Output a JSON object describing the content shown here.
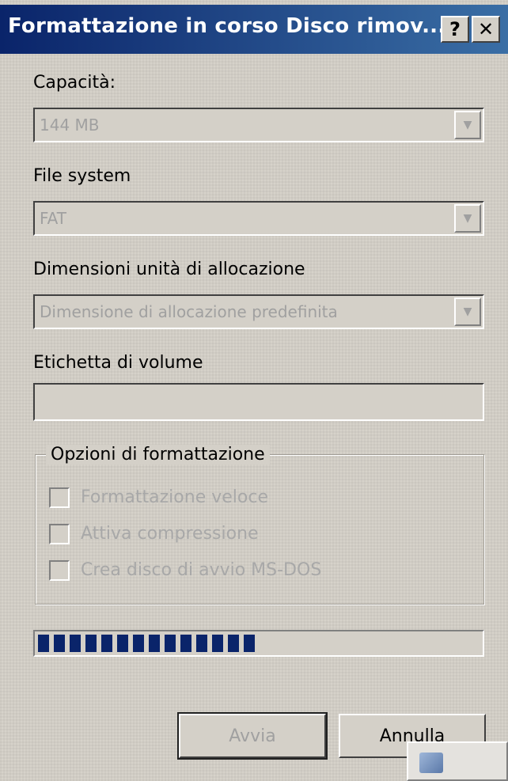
{
  "window": {
    "title": "Formattazione in corso Disco rimov...",
    "help_glyph": "?",
    "close_glyph": "✕"
  },
  "capacity": {
    "label": "Capacità:",
    "value": "144 MB"
  },
  "filesystem": {
    "label": "File system",
    "value": "FAT"
  },
  "allocation": {
    "label": "Dimensioni unità di allocazione",
    "value": "Dimensione di allocazione predefinita"
  },
  "volume": {
    "label": "Etichetta di volume",
    "value": ""
  },
  "options": {
    "title": "Opzioni di formattazione",
    "items": [
      {
        "label": "Formattazione veloce",
        "checked": false
      },
      {
        "label": "Attiva compressione",
        "checked": false
      },
      {
        "label": "Crea disco di avvio MS-DOS",
        "checked": false
      }
    ]
  },
  "progress": {
    "fraction": 0.52,
    "color": "#0a246a"
  },
  "buttons": {
    "start": "Avvia",
    "cancel": "Annulla"
  },
  "colors": {
    "titlebar_start": "#0a246a",
    "titlebar_end": "#3a6ea5",
    "face": "#d4d0c8"
  }
}
